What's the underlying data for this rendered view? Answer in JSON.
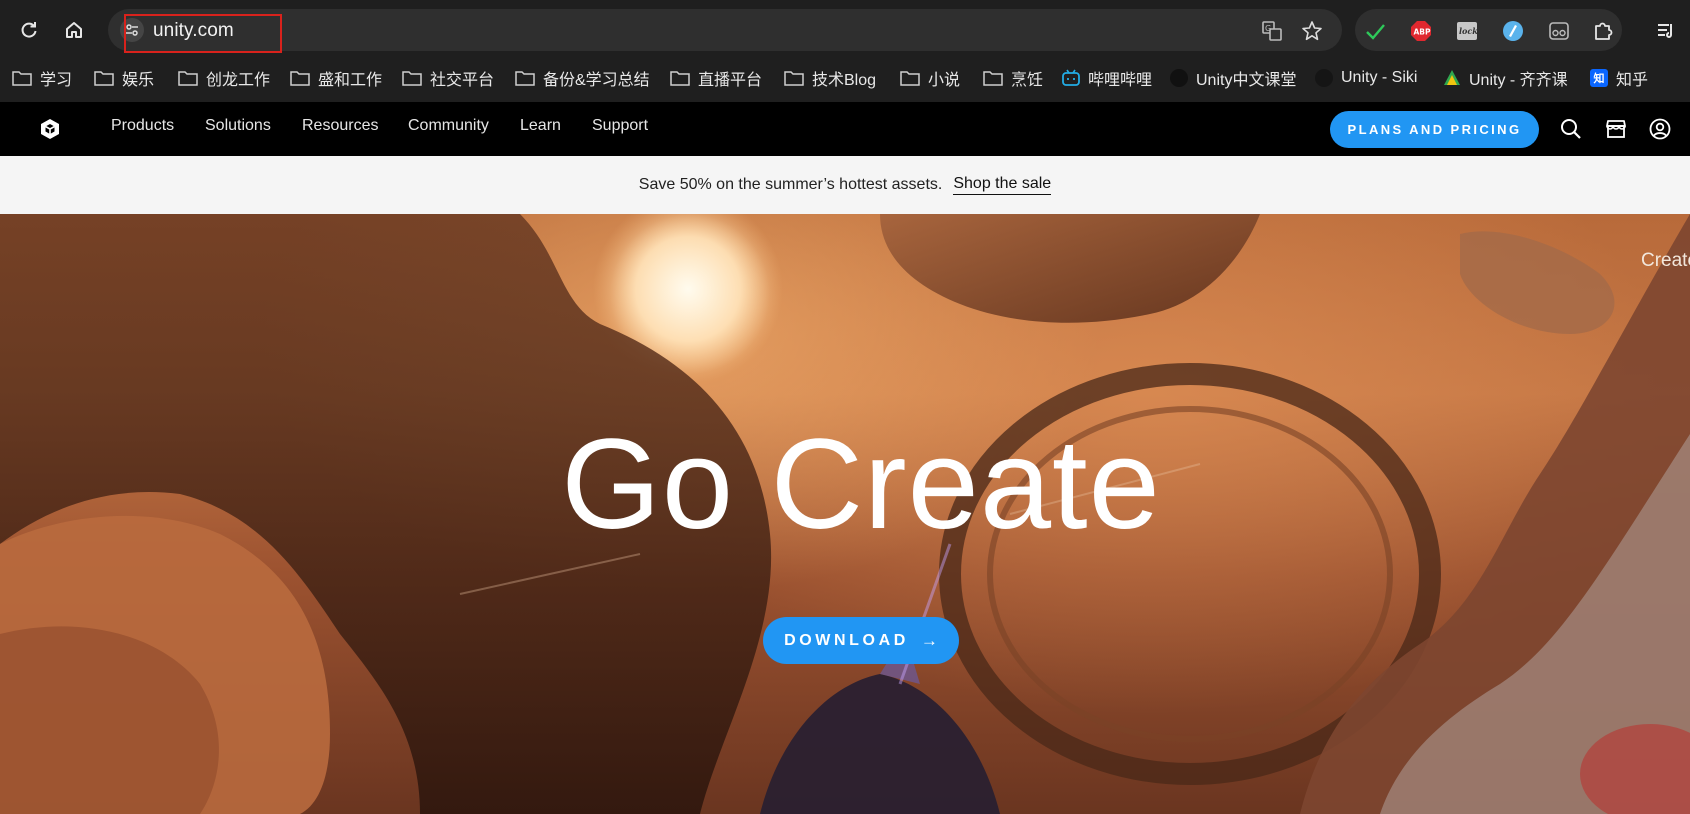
{
  "browser": {
    "url": "unity.com",
    "bookmarks": [
      {
        "label": "学习",
        "type": "folder"
      },
      {
        "label": "娱乐",
        "type": "folder"
      },
      {
        "label": "创龙工作",
        "type": "folder"
      },
      {
        "label": "盛和工作",
        "type": "folder"
      },
      {
        "label": "社交平台",
        "type": "folder"
      },
      {
        "label": "备份&学习总结",
        "type": "folder"
      },
      {
        "label": "直播平台",
        "type": "folder"
      },
      {
        "label": "技术Blog",
        "type": "folder"
      },
      {
        "label": "小说",
        "type": "folder"
      },
      {
        "label": "烹饪",
        "type": "folder"
      },
      {
        "label": "哔哩哔哩",
        "type": "site"
      },
      {
        "label": "Unity中文课堂",
        "type": "site"
      },
      {
        "label": "Unity - Siki",
        "type": "site"
      },
      {
        "label": "Unity - 齐齐课",
        "type": "site"
      },
      {
        "label": "知乎",
        "type": "site"
      }
    ],
    "extensions": {
      "abp": "ABP",
      "lock": "lock",
      "zhihu_badge": "知"
    }
  },
  "unity": {
    "nav": [
      "Products",
      "Solutions",
      "Resources",
      "Community",
      "Learn",
      "Support"
    ],
    "plans_label": "PLANS AND PRICING",
    "promo_text": "Save 50% on the summer’s hottest assets.",
    "promo_link": "Shop the sale",
    "hero_title": "Go Create",
    "download_label": "DOWNLOAD",
    "side_text": "Create"
  },
  "colors": {
    "accent": "#2196f3",
    "highlight": "#d9221c"
  }
}
